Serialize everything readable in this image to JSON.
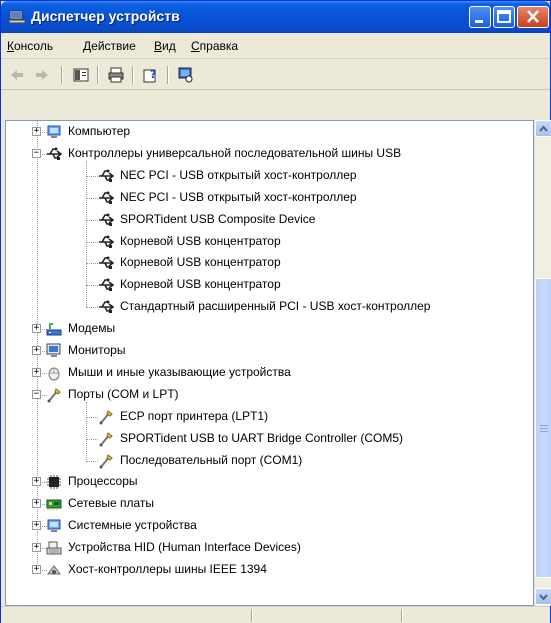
{
  "window": {
    "title": "Диспетчер устройств"
  },
  "menu": [
    {
      "prefix": "",
      "underline": "К",
      "rest": "онсоль"
    },
    {
      "prefix": "",
      "underline": "Д",
      "rest": "ействие"
    },
    {
      "prefix": "",
      "underline": "В",
      "rest": "ид"
    },
    {
      "prefix": "",
      "underline": "С",
      "rest": "правка"
    }
  ],
  "toolbar_icons": [
    "back-arrow-icon",
    "forward-arrow-icon",
    "properties-icon",
    "print-icon",
    "help-icon",
    "scan-hardware-icon"
  ],
  "tree": [
    {
      "label": "Компьютер",
      "level": 0,
      "expander": "+",
      "icon": "computer-icon"
    },
    {
      "label": "Контроллеры универсальной последовательной шины USB",
      "level": 0,
      "expander": "−",
      "icon": "usb-icon"
    },
    {
      "label": "NEC PCI - USB открытый хост-контроллер",
      "level": 1,
      "icon": "usb-icon"
    },
    {
      "label": "NEC PCI - USB открытый хост-контроллер",
      "level": 1,
      "icon": "usb-icon"
    },
    {
      "label": "SPORTident USB Composite Device",
      "level": 1,
      "icon": "usb-icon"
    },
    {
      "label": "Корневой USB концентратор",
      "level": 1,
      "icon": "usb-icon"
    },
    {
      "label": "Корневой USB концентратор",
      "level": 1,
      "icon": "usb-icon"
    },
    {
      "label": "Корневой USB концентратор",
      "level": 1,
      "icon": "usb-icon"
    },
    {
      "label": "Стандартный расширенный PCI - USB хост-контроллер",
      "level": 1,
      "icon": "usb-icon"
    },
    {
      "label": "Модемы",
      "level": 0,
      "expander": "+",
      "icon": "modem-icon"
    },
    {
      "label": "Мониторы",
      "level": 0,
      "expander": "+",
      "icon": "monitor-icon"
    },
    {
      "label": "Мыши и иные указывающие устройства",
      "level": 0,
      "expander": "+",
      "icon": "mouse-icon"
    },
    {
      "label": "Порты (COM и LPT)",
      "level": 0,
      "expander": "−",
      "icon": "port-icon"
    },
    {
      "label": "ECP порт принтера (LPT1)",
      "level": 1,
      "icon": "port-icon"
    },
    {
      "label": "SPORTident USB to UART Bridge Controller (COM5)",
      "level": 1,
      "icon": "port-icon"
    },
    {
      "label": "Последовательный порт (COM1)",
      "level": 1,
      "icon": "port-icon"
    },
    {
      "label": "Процессоры",
      "level": 0,
      "expander": "+",
      "icon": "processor-icon"
    },
    {
      "label": "Сетевые платы",
      "level": 0,
      "expander": "+",
      "icon": "network-card-icon"
    },
    {
      "label": "Системные устройства",
      "level": 0,
      "expander": "+",
      "icon": "computer-icon"
    },
    {
      "label": "Устройства HID (Human Interface Devices)",
      "level": 0,
      "expander": "+",
      "icon": "hid-icon"
    },
    {
      "label": "Хост-контроллеры шины IEEE 1394",
      "level": 0,
      "expander": "+",
      "icon": "ieee1394-icon"
    }
  ],
  "colors": {
    "titlebar": "#0a5fe0",
    "window_bg": "#ece9d8",
    "tree_bg": "#ffffff"
  }
}
